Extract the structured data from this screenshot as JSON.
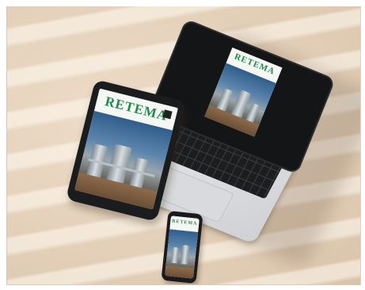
{
  "scene": {
    "description_colors": {
      "surface": "#e6d4bf",
      "brand_green": "#1f8a4a",
      "device_dark": "#1b1c1e",
      "laptop_silver": "#dcdee1"
    }
  },
  "laptop": {
    "logo": "RETEMA",
    "headline": ""
  },
  "tablet": {
    "logo": "RETEMA",
    "headline": ""
  },
  "phone": {
    "logo": "RETEMA"
  }
}
